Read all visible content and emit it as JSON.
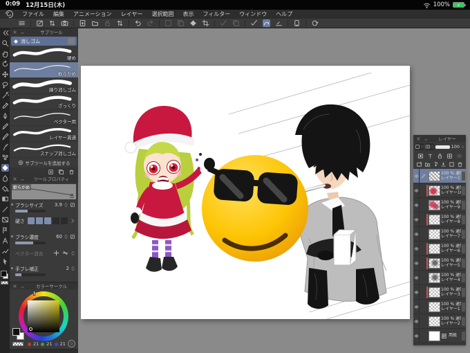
{
  "status_bar": {
    "time": "0:09",
    "date": "12月15日(木)",
    "battery": "100%"
  },
  "menu_bar": {
    "items": [
      "ファイル",
      "編集",
      "アニメーション",
      "レイヤー",
      "選択範囲",
      "表示",
      "フィルター",
      "ウィンドウ",
      "ヘルプ"
    ]
  },
  "command_bar": {
    "tools": [
      "main-menu",
      "register-work",
      "switch-order",
      "camera",
      "new-file",
      "open-file",
      "lock",
      "import-export",
      "undo",
      "redo",
      "deselect",
      "copy",
      "fill",
      "crop",
      "correcting-pen",
      "curve-pen",
      "straight-pen",
      "memo",
      "reset-view"
    ],
    "active": "curve-pen"
  },
  "tool_strip": {
    "selected": "eraser",
    "tools": [
      "collapse",
      "zoom",
      "hand",
      "rotate-canvas",
      "move",
      "lasso",
      "auto-select",
      "eyedropper",
      "pen",
      "pencil",
      "brush",
      "airbrush",
      "decoration",
      "eraser",
      "blend",
      "fill-bucket",
      "gradient",
      "figure",
      "frame-border",
      "ruler",
      "text",
      "correct-line",
      "operation"
    ]
  },
  "subtool_panel": {
    "title": "サブツール",
    "tool_name": "消しゴム",
    "items": [
      {
        "label": "硬め",
        "selected": false
      },
      {
        "label": "軟らかめ",
        "selected": true
      },
      {
        "label": "練り消しゴム",
        "selected": false
      },
      {
        "label": "ざっくり",
        "selected": false
      },
      {
        "label": "ベクター用",
        "selected": false
      },
      {
        "label": "レイヤー貫通",
        "selected": false
      },
      {
        "label": "スナップ消しゴム",
        "selected": false
      }
    ],
    "add_button": "サブツールを追加する"
  },
  "tool_property_panel": {
    "title": "ツールプロパティ",
    "preview_label": "軟らかめ",
    "brush_size_label": "ブラシサイズ",
    "brush_size_value": "3.9",
    "hardness_label": "硬さ",
    "hardness_level": "3/5",
    "density_label": "ブラシ濃度",
    "density_value": "60",
    "vector_erase_label": "ベクター消去",
    "stabilization_label": "手ブレ補正",
    "stabilization_value": "2"
  },
  "color_panel": {
    "title": "カラーサークル",
    "r": "21",
    "g": "21",
    "b": "21",
    "selected_color": "#151515",
    "dot_colors": {
      "r": "#c33a36",
      "g": "#3aa53a",
      "b": "#2d4fd2"
    }
  },
  "layer_panel": {
    "title": "レイヤー",
    "opacity": "100",
    "layers": [
      {
        "info": "100 % 通常",
        "name": "レイヤー11",
        "clip": false,
        "selected": true
      },
      {
        "info": "100 % 通常",
        "name": "レイヤー10",
        "clip": true,
        "selected": false
      },
      {
        "info": "100 % 通常",
        "name": "レイヤー9",
        "clip": false,
        "selected": false
      },
      {
        "info": "100 % 通常",
        "name": "レイヤー8",
        "clip": true,
        "selected": false
      },
      {
        "info": "100 % 通常",
        "name": "レイヤー7",
        "clip": false,
        "selected": false
      },
      {
        "info": "100 % 通常",
        "name": "レイヤー6",
        "clip": true,
        "selected": false
      },
      {
        "info": "100 % 通常",
        "name": "レイヤー5",
        "clip": true,
        "selected": false
      },
      {
        "info": "100 % 通常",
        "name": "レイヤー4",
        "clip": false,
        "selected": false
      },
      {
        "info": "100 % 通常",
        "name": "レイヤー3",
        "clip": true,
        "selected": false
      },
      {
        "info": "100 % 通常",
        "name": "レイヤー1",
        "clip": false,
        "selected": false
      },
      {
        "info": "100 % 通常",
        "name": "レイヤー2",
        "clip": false,
        "selected": false
      }
    ],
    "paper_layer": "用紙"
  },
  "artwork_colors": {
    "emoji_yellow": "#fdc500",
    "santa_red": "#c8183f",
    "hair_green": "#b9cf3e",
    "suit_gray": "#bdbdbd"
  }
}
